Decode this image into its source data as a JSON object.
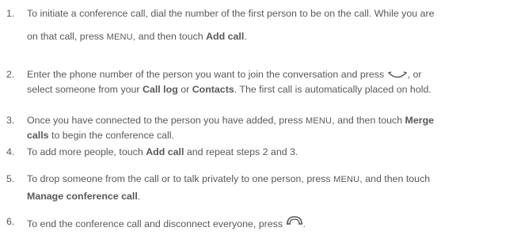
{
  "steps": [
    {
      "number": "1.",
      "line1": "To initiate a conference call, dial the number of the first person to be on the call. While you are",
      "line2_a": "on that call, press",
      "key": "MENU",
      "line2_b": ", and then touch",
      "bold": "Add call",
      "end": "."
    },
    {
      "number": "2.",
      "line1_a": "Enter the phone number of the person you want to join the conversation and press",
      "icon": "call-send-icon",
      "line1_b": ", or",
      "line2_a": "select someone from your",
      "bold1": "Call log",
      "line2_b": "or",
      "bold2": "Contacts",
      "line2_c": ". The first call is automatically placed on hold."
    },
    {
      "number": "3.",
      "line1_a": "Once you have connected to the person you have added, press",
      "key": "MENU",
      "line1_b": ", and then touch",
      "bold_line1": "Merge",
      "bold_line2": "calls",
      "line2_a": "to begin the conference call."
    },
    {
      "number": "4.",
      "text_a": "To add more people, touch",
      "bold": "Add call",
      "text_b": "and repeat steps 2 and 3."
    },
    {
      "number": "5.",
      "line1_a": "To drop someone from the call or to talk privately to one person, press",
      "key": "MENU",
      "line1_b": ", and then touch",
      "bold": "Manage conference call",
      "end": "."
    },
    {
      "number": "6.",
      "text": "To end the conference call and disconnect everyone, press",
      "icon": "end-call-icon",
      "end": "."
    }
  ],
  "colors": {
    "text": "#58595b",
    "icon": "#58595b"
  }
}
